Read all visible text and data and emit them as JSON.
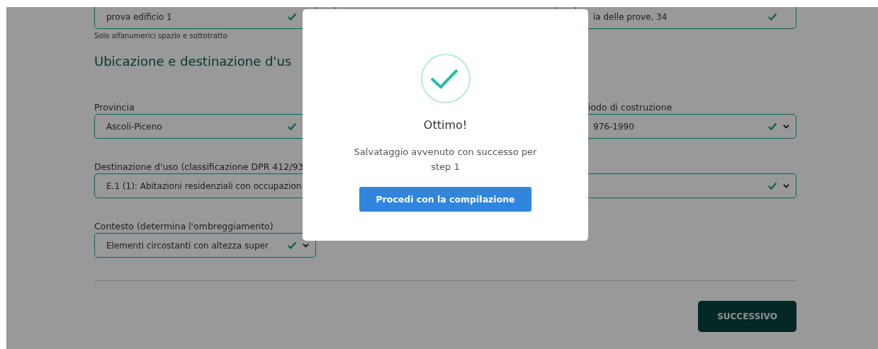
{
  "form": {
    "top_row": [
      {
        "kind": "field",
        "value": "prova edificio 1",
        "valid": true
      },
      {
        "kind": "field"
      },
      {
        "kind": "field",
        "value": "ia delle prove, 34",
        "valid": true
      }
    ],
    "hint": "Solo alfanumerici spazio e sottotratto",
    "section_title": "Ubicazione e destinazione d'us",
    "rows": [
      [
        {
          "kind": "field",
          "label": "Provincia",
          "value": "Ascoli-Piceno",
          "valid": true
        },
        null,
        {
          "kind": "field",
          "label": "iodo di costruzione",
          "value": "976-1990",
          "valid": true,
          "dropdown": true
        }
      ],
      [
        {
          "kind": "field",
          "label": "Destinazione d'uso (classificazione DPR 412/93",
          "value": "E.1 (1): Abitazioni residenziali con occupazion"
        },
        null,
        {
          "kind": "field",
          "valid": true,
          "dropdown": true
        }
      ],
      [
        {
          "kind": "field",
          "label": "Contesto (determina l'ombreggiamento)",
          "value": "Elementi circostanti con altezza super",
          "valid": true,
          "dropdown": true
        },
        null,
        null
      ]
    ],
    "next_button": "SUCCESSIVO"
  },
  "modal": {
    "title": "Ottimo!",
    "message": "Salvataggio avvenuto con successo per step 1",
    "button": "Procedi con la compilazione"
  }
}
